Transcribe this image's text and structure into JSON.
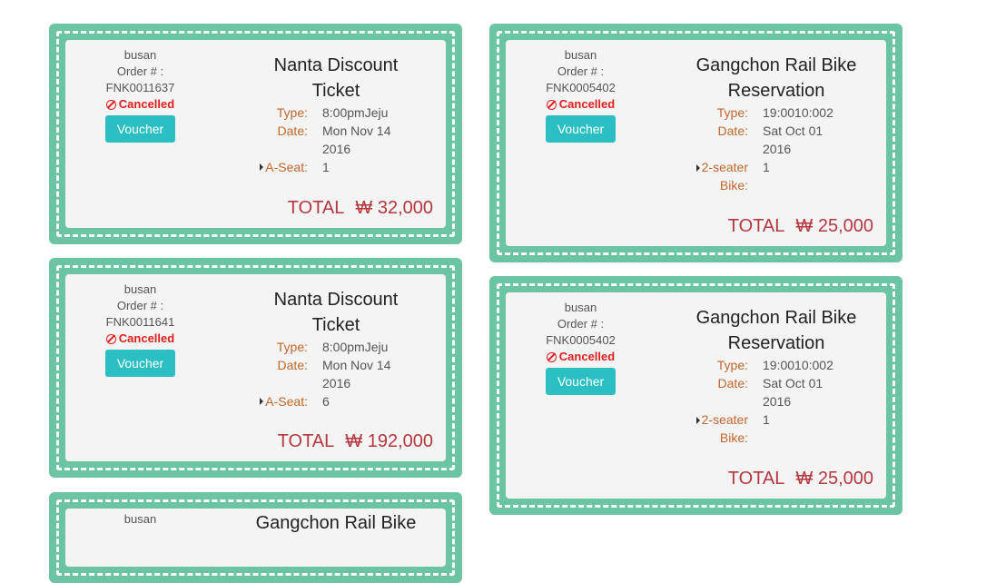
{
  "tickets": [
    {
      "img_alt": "busan",
      "order_label": "Order # :",
      "order_no": "FNK0011637",
      "status": "Cancelled",
      "voucher": "Voucher",
      "title_line1": "Nanta Discount",
      "title_line2": "Ticket",
      "type_label": "Type:",
      "type_value": "8:00pmJeju",
      "date_label": "Date:",
      "date_line1": "Mon Nov 14",
      "date_line2": "2016",
      "seat_label_line1": "A-Seat:",
      "seat_label_line2": "",
      "seat_value": "1",
      "total_label": "TOTAL",
      "total_amount": "₩ 32,000"
    },
    {
      "img_alt": "busan",
      "order_label": "Order # :",
      "order_no": "FNK0005402",
      "status": "Cancelled",
      "voucher": "Voucher",
      "title_line1": "Gangchon Rail Bike",
      "title_line2": "Reservation",
      "type_label": "Type:",
      "type_value": "19:0010:002",
      "date_label": "Date:",
      "date_line1": "Sat Oct 01",
      "date_line2": "2016",
      "seat_label_line1": "2-seater",
      "seat_label_line2": "Bike:",
      "seat_value": "1",
      "total_label": "TOTAL",
      "total_amount": "₩ 25,000"
    },
    {
      "img_alt": "busan",
      "order_label": "Order # :",
      "order_no": "FNK0011641",
      "status": "Cancelled",
      "voucher": "Voucher",
      "title_line1": "Nanta Discount",
      "title_line2": "Ticket",
      "type_label": "Type:",
      "type_value": "8:00pmJeju",
      "date_label": "Date:",
      "date_line1": "Mon Nov 14",
      "date_line2": "2016",
      "seat_label_line1": "A-Seat:",
      "seat_label_line2": "",
      "seat_value": "6",
      "total_label": "TOTAL",
      "total_amount": "₩ 192,000"
    },
    {
      "img_alt": "busan",
      "order_label": "Order # :",
      "order_no": "FNK0005402",
      "status": "Cancelled",
      "voucher": "Voucher",
      "title_line1": "Gangchon Rail Bike",
      "title_line2": "Reservation",
      "type_label": "Type:",
      "type_value": "19:0010:002",
      "date_label": "Date:",
      "date_line1": "Sat Oct 01",
      "date_line2": "2016",
      "seat_label_line1": "2-seater",
      "seat_label_line2": "Bike:",
      "seat_value": "1",
      "total_label": "TOTAL",
      "total_amount": "₩ 25,000"
    },
    {
      "img_alt": "busan",
      "title_line1": "Gangchon Rail Bike"
    }
  ],
  "colors": {
    "ticket_green": "#6bc5a3",
    "status_red": "#e01e1e",
    "voucher_teal": "#2bbfc4",
    "label_orange": "#c2672c",
    "total_red": "#b5373f"
  }
}
